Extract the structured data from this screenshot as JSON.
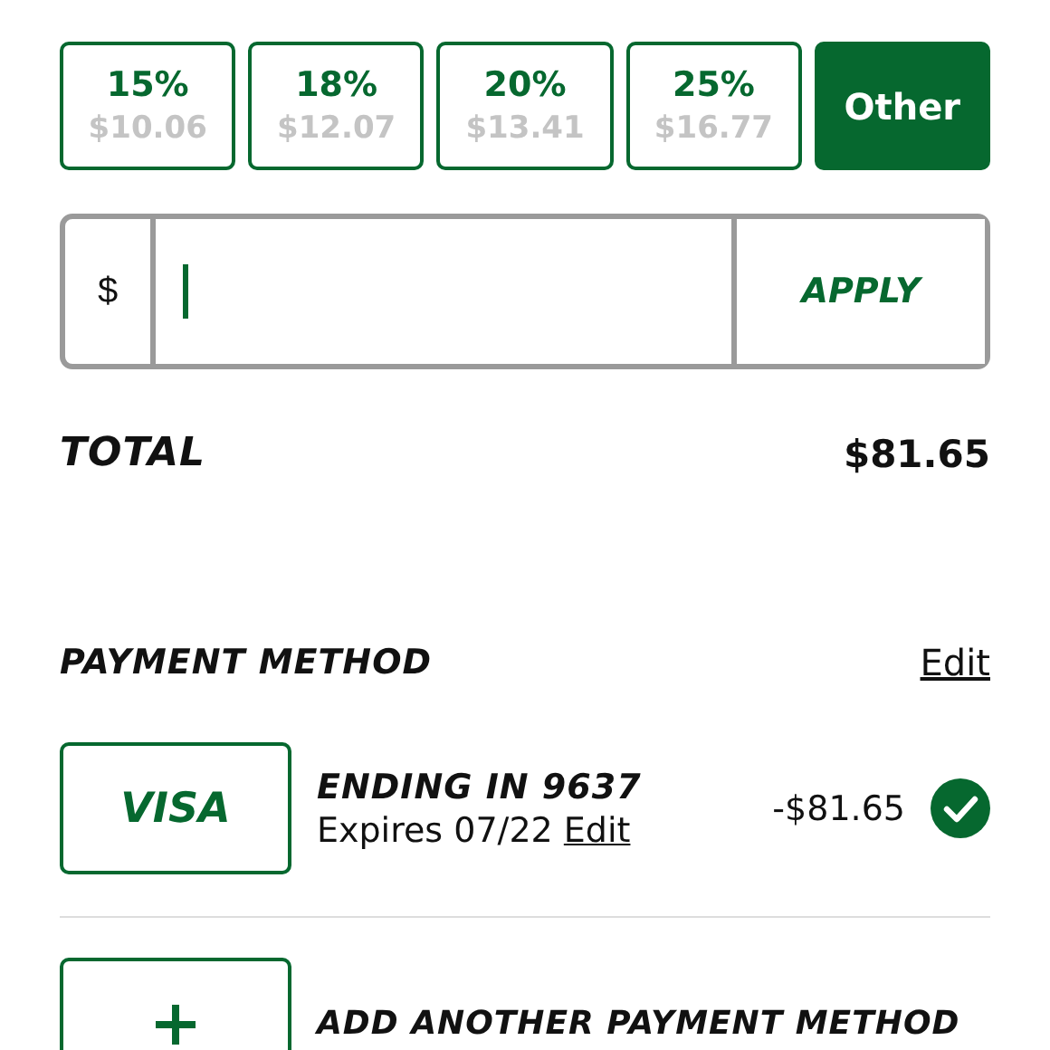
{
  "tips": [
    {
      "label": "15%",
      "amount": "$10.06",
      "selected": false
    },
    {
      "label": "18%",
      "amount": "$12.07",
      "selected": false
    },
    {
      "label": "20%",
      "amount": "$13.41",
      "selected": false
    },
    {
      "label": "25%",
      "amount": "$16.77",
      "selected": false
    },
    {
      "label": "Other",
      "selected": true
    }
  ],
  "custom_tip": {
    "currency": "$",
    "apply": "APPLY"
  },
  "total": {
    "label": "TOTAL",
    "value": "$81.65"
  },
  "payment": {
    "heading": "PAYMENT METHOD",
    "edit": "Edit",
    "methods": [
      {
        "brand": "VISA",
        "title": "ENDING IN 9637",
        "expires": "Expires 07/22",
        "edit": "Edit",
        "amount": "-$81.65",
        "selected": true
      }
    ],
    "add_label": "ADD ANOTHER PAYMENT METHOD"
  }
}
